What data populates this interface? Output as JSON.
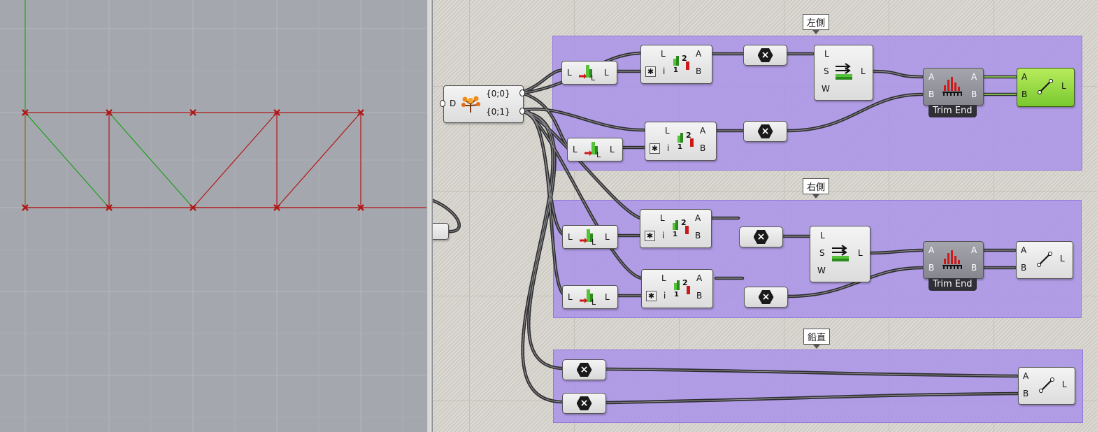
{
  "colors": {
    "viewport_bg": "#a4a8ae",
    "canvas_bg": "#d5d2ca",
    "group_fill": "#a88feb",
    "wire": "#3a3a3a",
    "truss_red": "#b01818",
    "truss_green": "#1aa01a",
    "line_component_green": "#8ed640"
  },
  "groups": [
    {
      "label": "左側"
    },
    {
      "label": "右側"
    },
    {
      "label": "鉛直"
    }
  ],
  "tree_component": {
    "input": "D",
    "output_paths": [
      "{0;0}",
      "{0;1}"
    ],
    "icon": "tree-icon"
  },
  "list_item": {
    "input": "L",
    "output": "L",
    "icon": "list-item-icon"
  },
  "split_list": {
    "inputs": [
      "L",
      "i"
    ],
    "outputs": [
      "A",
      "B"
    ],
    "icon": "split-list-icon"
  },
  "negate": {
    "symbol": "×",
    "icon": "negate-hex-icon"
  },
  "shift_list": {
    "inputs": [
      "L",
      "S",
      "W"
    ],
    "output": "L",
    "icon": "shift-list-icon"
  },
  "trim_end": {
    "inputs": [
      "A",
      "B"
    ],
    "outputs": [
      "A",
      "B"
    ],
    "caption": "Trim End",
    "icon": "trim-end-icon"
  },
  "line": {
    "inputs": [
      "A",
      "B"
    ],
    "output": "L",
    "icon": "line-icon"
  }
}
